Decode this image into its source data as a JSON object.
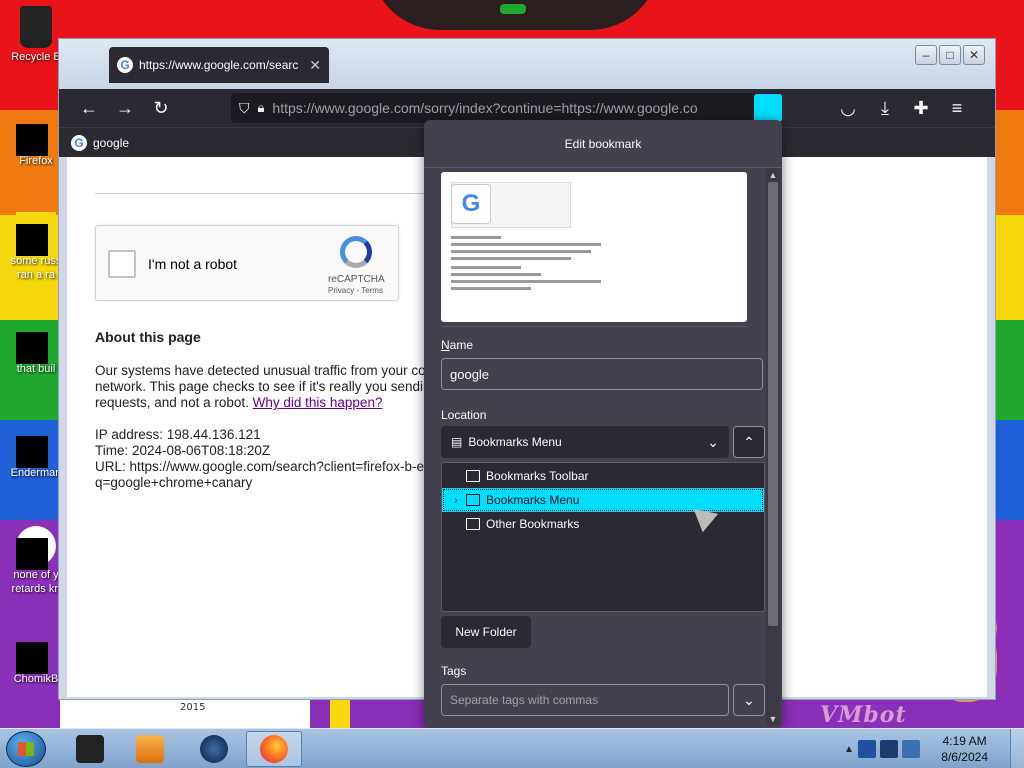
{
  "desktop": {
    "icons": [
      {
        "label": "Recycle B",
        "name": "desktop-icon-recycle-bin"
      },
      {
        "label": "Firefox",
        "name": "desktop-icon-firefox"
      },
      {
        "label": "some russ",
        "label2": "ran a ra",
        "name": "desktop-icon-some-russ"
      },
      {
        "label": "that buil",
        "name": "desktop-icon-that-buil"
      },
      {
        "label": "Enderman",
        "name": "desktop-icon-enderman"
      },
      {
        "label": "none of y",
        "label2": "retards kn",
        "name": "desktop-icon-none-of-y"
      },
      {
        "label": "ChomikB",
        "name": "desktop-icon-chomikb"
      }
    ],
    "wallpaper_year": "2015",
    "wallpaper_text": "VMbot"
  },
  "browser": {
    "tab_title": "https://www.google.com/searc",
    "url": "https://www.google.com/sorry/index?continue=https://www.google.co",
    "url_host": "google.com",
    "bookmark_item": "google",
    "accent": "#00ddff"
  },
  "page": {
    "recaptcha_label": "I'm not a robot",
    "recaptcha_brand": "reCAPTCHA",
    "recaptcha_terms": "Privacy - Terms",
    "about_heading": "About this page",
    "para_line1": "Our systems have detected unusual traffic from your com",
    "para_line2": "network.  This page checks to see if it's really you sending",
    "para_line3": "requests, and not a robot.",
    "why_link": "Why did this happen?",
    "ip": "IP address: 198.44.136.121",
    "time": "Time: 2024-08-06T08:18:20Z",
    "url_line1": "URL: https://www.google.com/search?client=firefox-b-e&",
    "url_line2": "q=google+chrome+canary"
  },
  "bookmark_panel": {
    "title": "Edit bookmark",
    "name_label_u": "N",
    "name_label_rest": "ame",
    "name_value": "google",
    "location_label": "Location",
    "location_value": "Bookmarks Menu",
    "folders": [
      {
        "label": "Bookmarks Toolbar",
        "selected": false
      },
      {
        "label": "Bookmarks Menu",
        "selected": true
      },
      {
        "label": "Other Bookmarks",
        "selected": false
      }
    ],
    "new_folder_label": "New Folder",
    "tags_label": "Tags",
    "tags_placeholder": "Separate tags with commas"
  },
  "taskbar": {
    "time": "4:19 AM",
    "date": "8/6/2024"
  }
}
